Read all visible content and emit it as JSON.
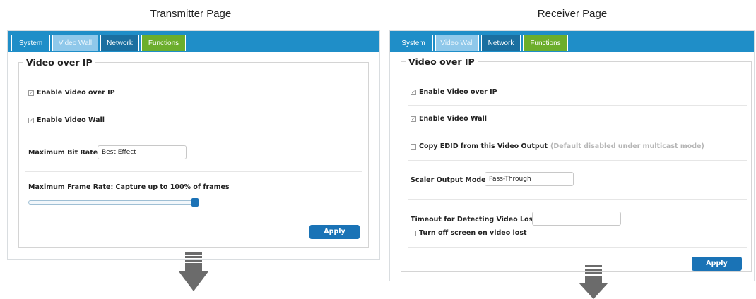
{
  "transmitter": {
    "caption": "Transmitter Page",
    "tabs": [
      "System",
      "Video Wall",
      "Network",
      "Functions"
    ],
    "section_title": "Video over IP",
    "enable_video_over_ip": {
      "label": "Enable Video over IP",
      "checked": true
    },
    "enable_video_wall": {
      "label": "Enable Video Wall",
      "checked": true
    },
    "max_bit_rate": {
      "label": "Maximum Bit Rate:",
      "value": "Best Effect"
    },
    "max_frame_rate": {
      "label": "Maximum Frame Rate: Capture up to 100% of frames",
      "percent": 100
    },
    "apply_label": "Apply"
  },
  "receiver": {
    "caption": "Receiver Page",
    "tabs": [
      "System",
      "Video Wall",
      "Network",
      "Functions"
    ],
    "section_title": "Video over IP",
    "enable_video_over_ip": {
      "label": "Enable Video over IP",
      "checked": true
    },
    "enable_video_wall": {
      "label": "Enable Video Wall",
      "checked": true
    },
    "copy_edid": {
      "label": "Copy EDID from this Video Output",
      "hint": "(Default disabled under multicast mode)",
      "checked": false
    },
    "scaler_output_mode": {
      "label": "Scaler Output Mode:",
      "value": "Pass-Through"
    },
    "timeout_video_lost": {
      "label": "Timeout for Detecting Video Lost:",
      "value": ""
    },
    "turn_off_screen": {
      "label": "Turn off screen on video lost",
      "checked": false
    },
    "apply_label": "Apply"
  },
  "colors": {
    "tabbar": "#1f8ec8",
    "tab_active": "#8fc8ea",
    "tab_functions": "#6cae2c",
    "apply_button": "#1a73b6",
    "arrow": "#6b6b6b"
  }
}
